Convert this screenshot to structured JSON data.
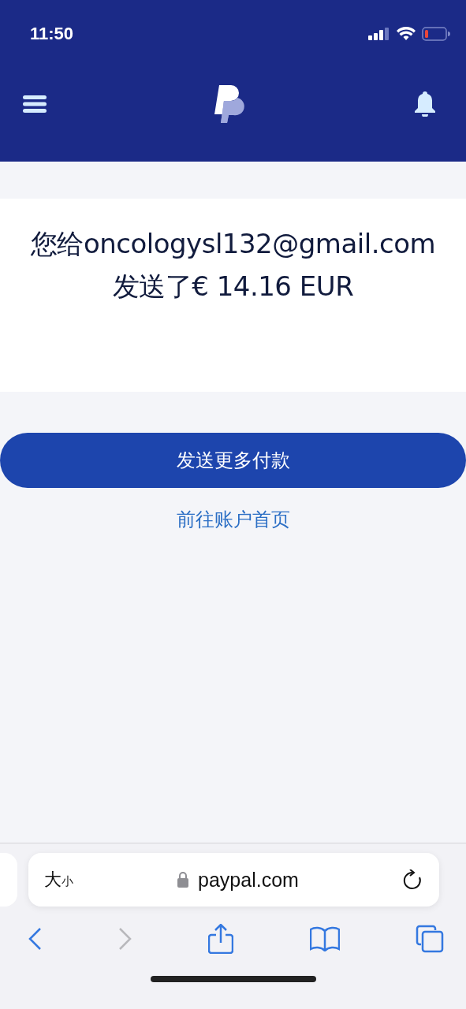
{
  "status_bar": {
    "time": "11:50"
  },
  "message": {
    "text": "您给oncologysl132@gmail.com发送了€ 14.16 EUR"
  },
  "actions": {
    "primary_button": "发送更多付款",
    "link": "前往账户首页"
  },
  "browser": {
    "text_size_button": {
      "large": "大",
      "small": "小"
    },
    "url": "paypal.com",
    "toolbar": [
      {
        "kind": "back",
        "disabled": false
      },
      {
        "kind": "forward",
        "disabled": true
      },
      {
        "kind": "share",
        "disabled": false
      },
      {
        "kind": "bookmarks",
        "disabled": false
      },
      {
        "kind": "tabs",
        "disabled": false
      }
    ]
  }
}
